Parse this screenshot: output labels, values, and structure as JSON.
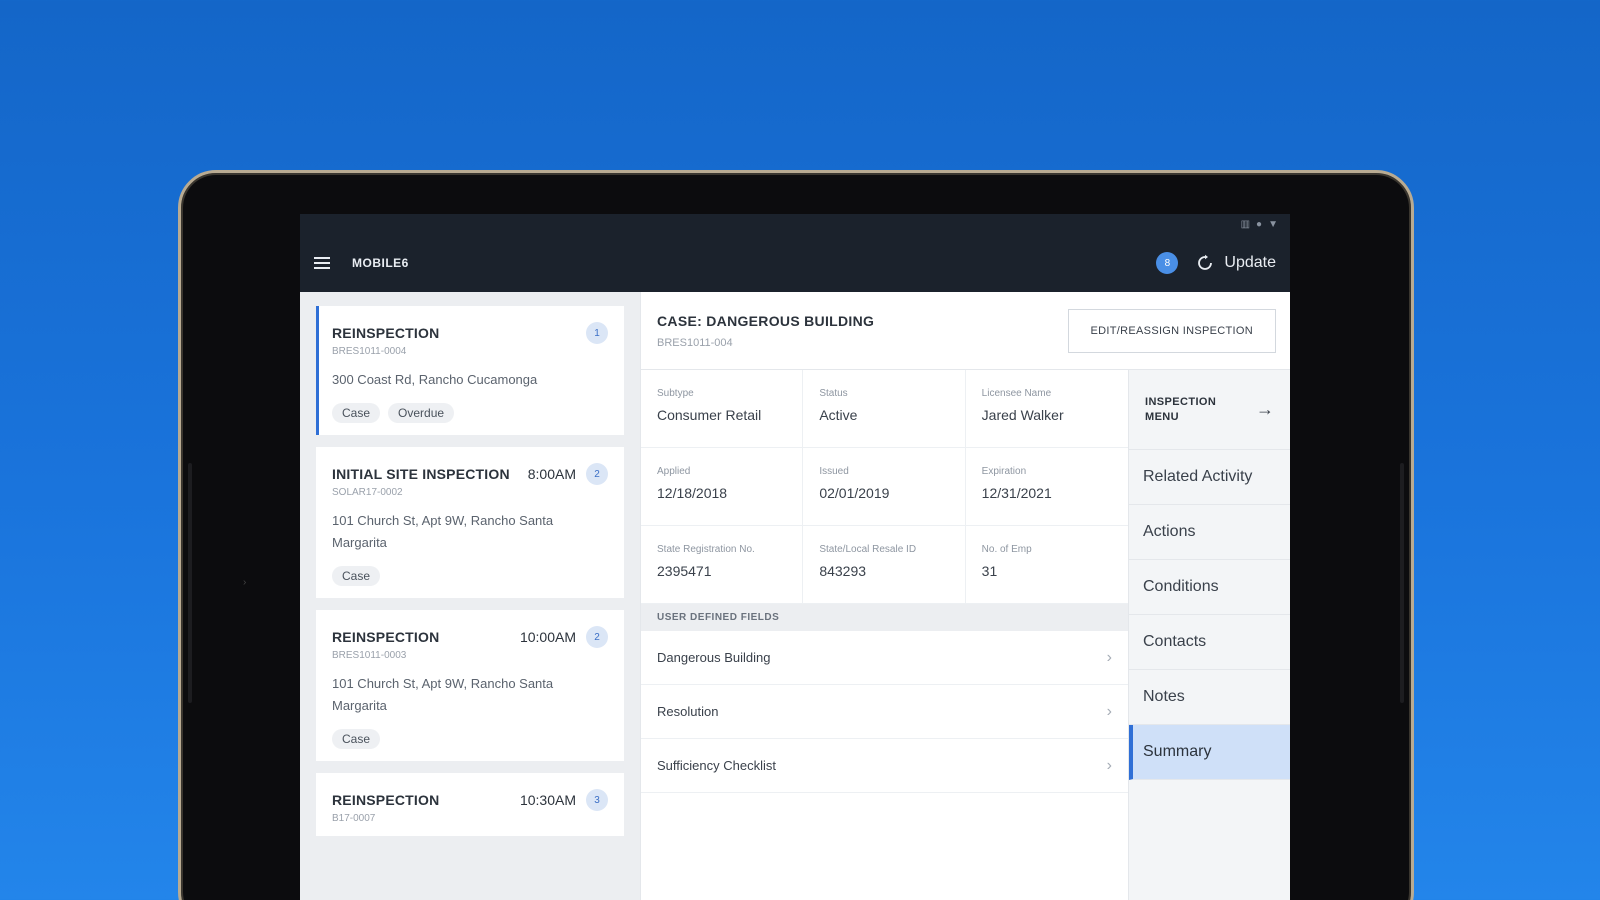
{
  "app": {
    "title": "MOBILE6",
    "notification_count": "8",
    "update_label": "Update"
  },
  "statusbar": {
    "icons": [
      "signal-icon",
      "wifi-icon",
      "battery-icon"
    ]
  },
  "inspections": [
    {
      "title": "REINSPECTION",
      "time": "",
      "number": "1",
      "id": "BRES1011-0004",
      "address": "300 Coast Rd, Rancho Cucamonga",
      "tags": [
        "Case",
        "Overdue"
      ],
      "active": true
    },
    {
      "title": "INITIAL SITE INSPECTION",
      "time": "8:00AM",
      "number": "2",
      "id": "SOLAR17-0002",
      "address": "101 Church St, Apt 9W, Rancho Santa Margarita",
      "tags": [
        "Case"
      ],
      "active": false
    },
    {
      "title": "REINSPECTION",
      "time": "10:00AM",
      "number": "2",
      "id": "BRES1011-0003",
      "address": "101 Church St, Apt 9W, Rancho Santa Margarita",
      "tags": [
        "Case"
      ],
      "active": false
    },
    {
      "title": "REINSPECTION",
      "time": "10:30AM",
      "number": "3",
      "id": "B17-0007",
      "address": "",
      "tags": [],
      "active": false
    }
  ],
  "case": {
    "title": "CASE: DANGEROUS BUILDING",
    "id": "BRES1011-004",
    "edit_button": "EDIT/REASSIGN INSPECTION",
    "fields": [
      {
        "label": "Subtype",
        "value": "Consumer Retail"
      },
      {
        "label": "Status",
        "value": "Active"
      },
      {
        "label": "Licensee Name",
        "value": "Jared Walker"
      },
      {
        "label": "Applied",
        "value": "12/18/2018"
      },
      {
        "label": "Issued",
        "value": "02/01/2019"
      },
      {
        "label": "Expiration",
        "value": "12/31/2021"
      },
      {
        "label": "State Registration No.",
        "value": "2395471"
      },
      {
        "label": "State/Local Resale ID",
        "value": "843293"
      },
      {
        "label": "No. of Emp",
        "value": "31"
      }
    ],
    "user_defined_header": "USER DEFINED FIELDS",
    "user_defined_rows": [
      "Dangerous Building",
      "Resolution",
      "Sufficiency Checklist"
    ]
  },
  "inspection_menu": {
    "title": "INSPECTION MENU",
    "items": [
      "Related Activity",
      "Actions",
      "Conditions",
      "Contacts",
      "Notes",
      "Summary"
    ],
    "selected": "Summary"
  }
}
